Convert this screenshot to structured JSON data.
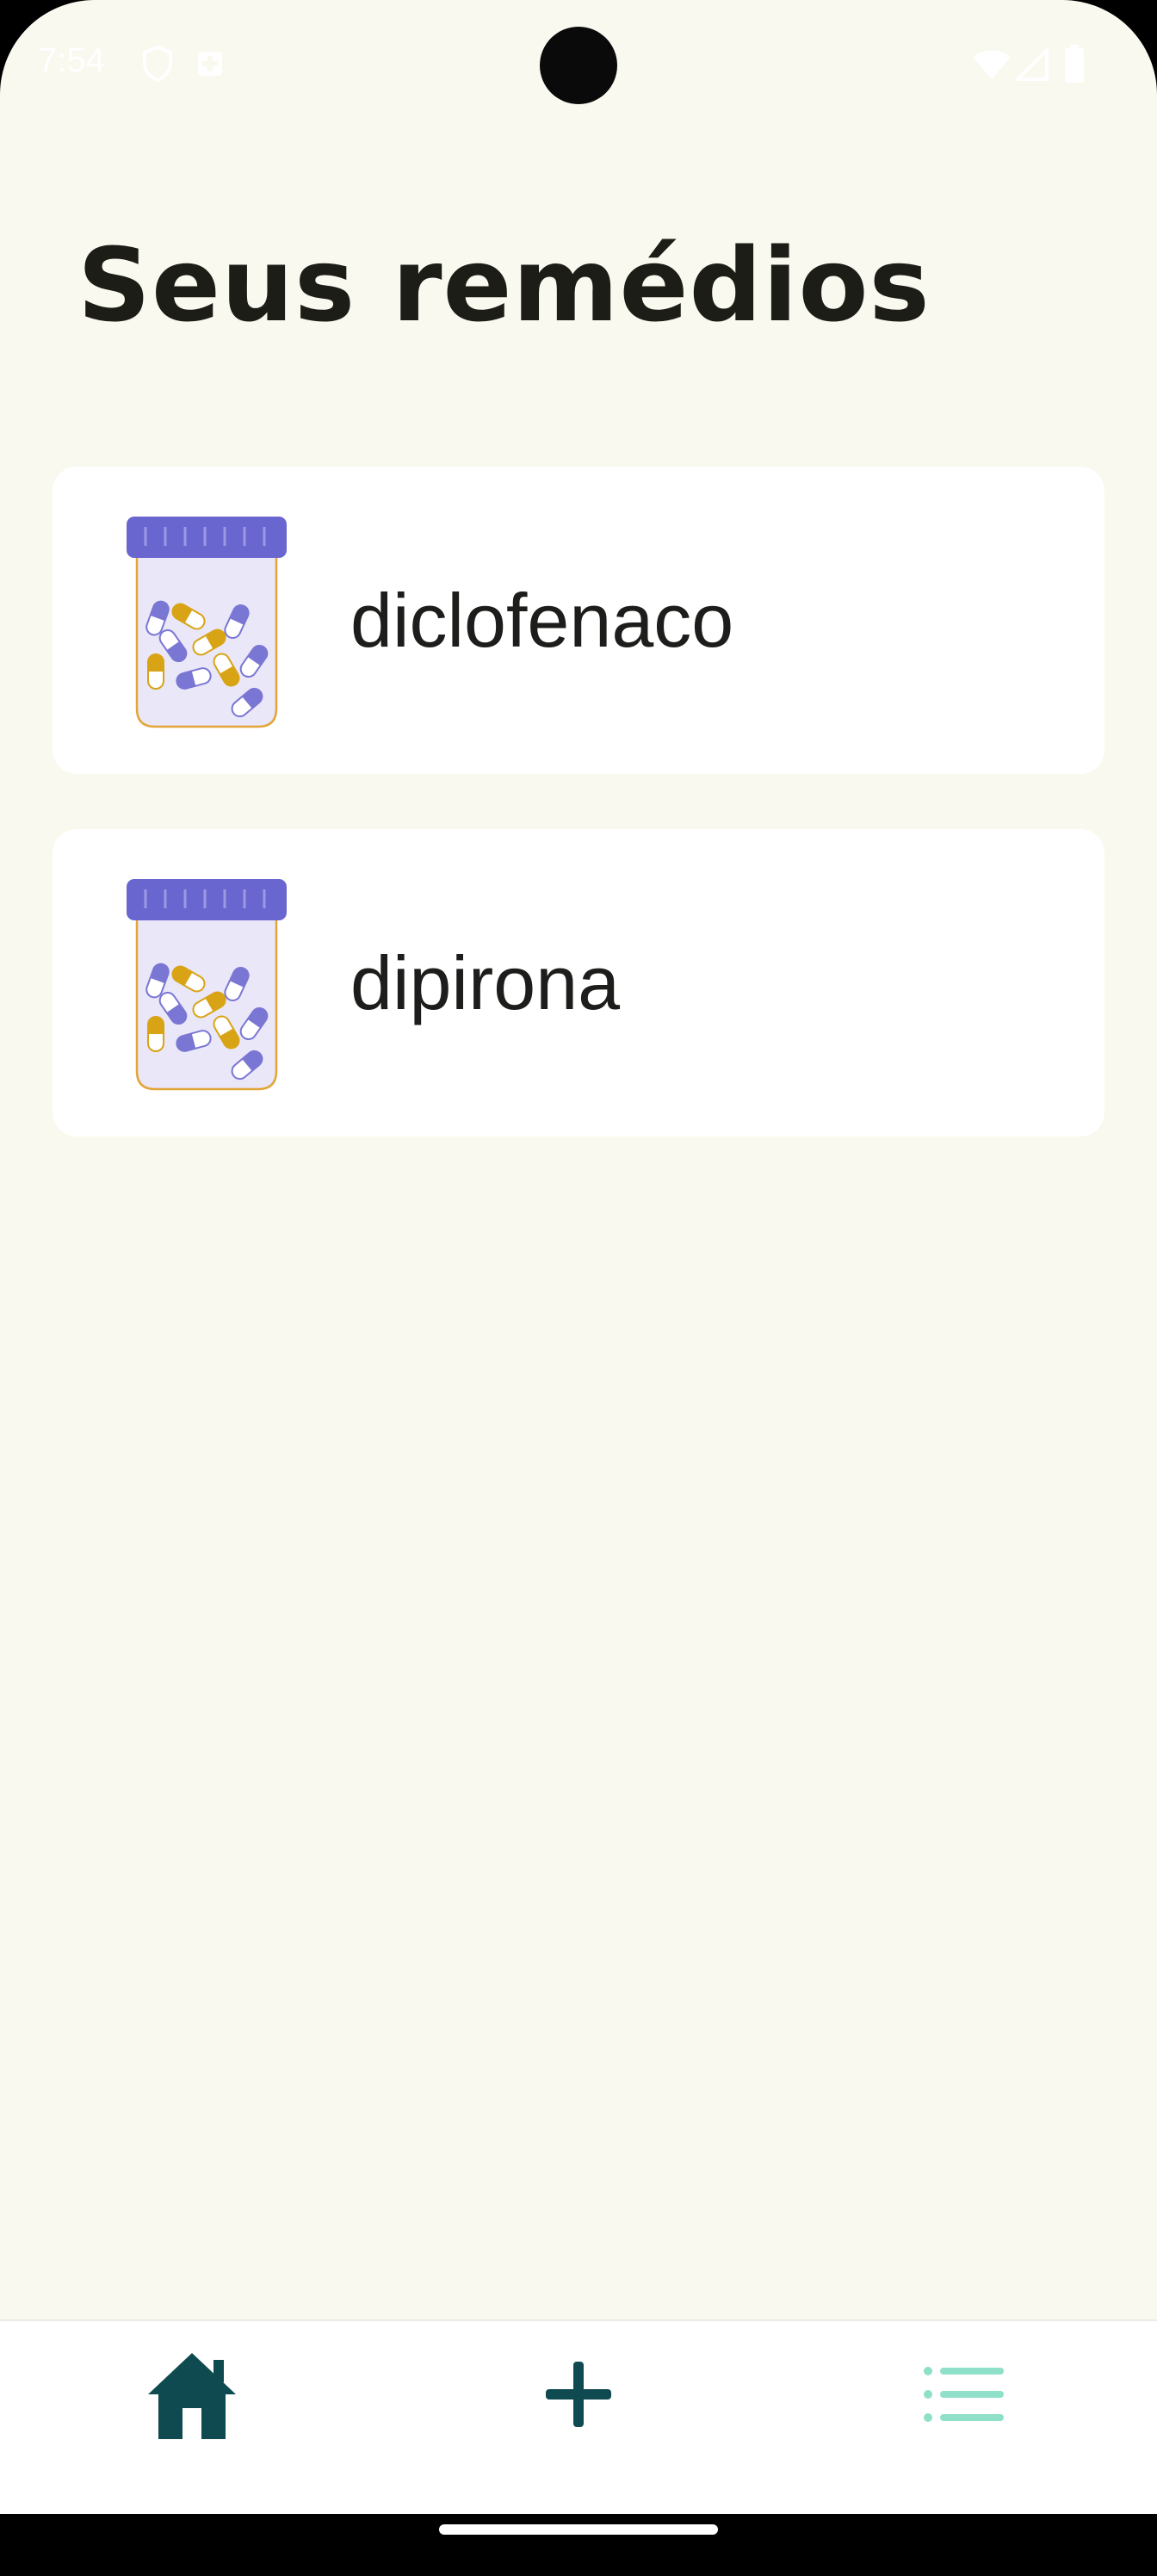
{
  "status_bar": {
    "time": "7:54",
    "icons": [
      "shield-icon",
      "notification-app-icon",
      "wifi-icon",
      "signal-icon",
      "battery-icon"
    ]
  },
  "header": {
    "title": "Seus remédios"
  },
  "medications": [
    {
      "name": "diclofenaco",
      "icon": "pill-bottle-icon"
    },
    {
      "name": "dipirona",
      "icon": "pill-bottle-icon"
    }
  ],
  "bottom_nav": {
    "items": [
      {
        "icon": "home-icon",
        "active": true,
        "color": "#0e4a4f"
      },
      {
        "icon": "plus-icon",
        "active": false,
        "color": "#0e4a4f"
      },
      {
        "icon": "list-icon",
        "active": false,
        "color": "#8fe0c8"
      }
    ]
  },
  "colors": {
    "background": "#f9f9ef",
    "card": "#ffffff",
    "bottle_cap": "#6a66cf",
    "bottle_body": "#e9e7f8",
    "bottle_outline": "#e3a53a",
    "pill_yellow": "#d9a316",
    "pill_purple": "#7a76d4",
    "nav_dark": "#0e4a4f",
    "nav_light": "#8fe0c8"
  }
}
